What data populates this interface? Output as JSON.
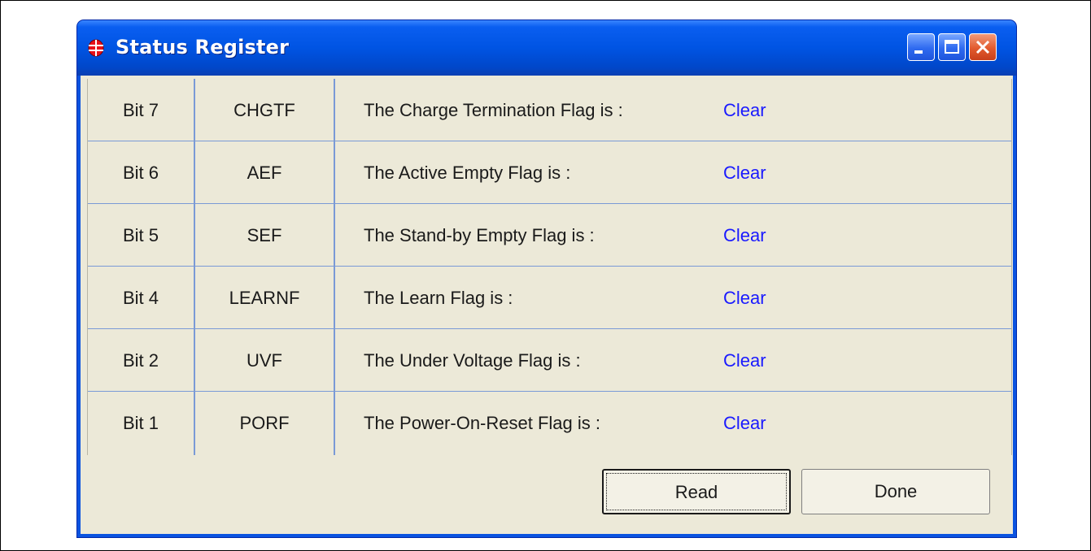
{
  "window": {
    "title": "Status Register",
    "icon": "app-logo-icon",
    "controls": [
      "minimize-icon",
      "maximize-icon",
      "close-icon"
    ]
  },
  "rows": [
    {
      "bit": "Bit 7",
      "name": "CHGTF",
      "description": "The Charge Termination Flag is :",
      "status": "Clear"
    },
    {
      "bit": "Bit 6",
      "name": "AEF",
      "description": "The Active Empty Flag  is :",
      "status": "Clear"
    },
    {
      "bit": "Bit 5",
      "name": "SEF",
      "description": "The Stand-by Empty Flag  is :",
      "status": "Clear"
    },
    {
      "bit": "Bit 4",
      "name": "LEARNF",
      "description": "The Learn Flag is :",
      "status": "Clear"
    },
    {
      "bit": "Bit 2",
      "name": "UVF",
      "description": "The Under Voltage Flag is :",
      "status": "Clear"
    },
    {
      "bit": "Bit 1",
      "name": "PORF",
      "description": "The Power-On-Reset Flag is :",
      "status": "Clear"
    }
  ],
  "buttons": {
    "read_label": "Read",
    "done_label": "Done"
  },
  "colors": {
    "status_text": "#1a1aff",
    "titlebar": "#0054e3",
    "dialog_bg": "#ece9d8",
    "grid_lines": "#7a9ad6"
  }
}
